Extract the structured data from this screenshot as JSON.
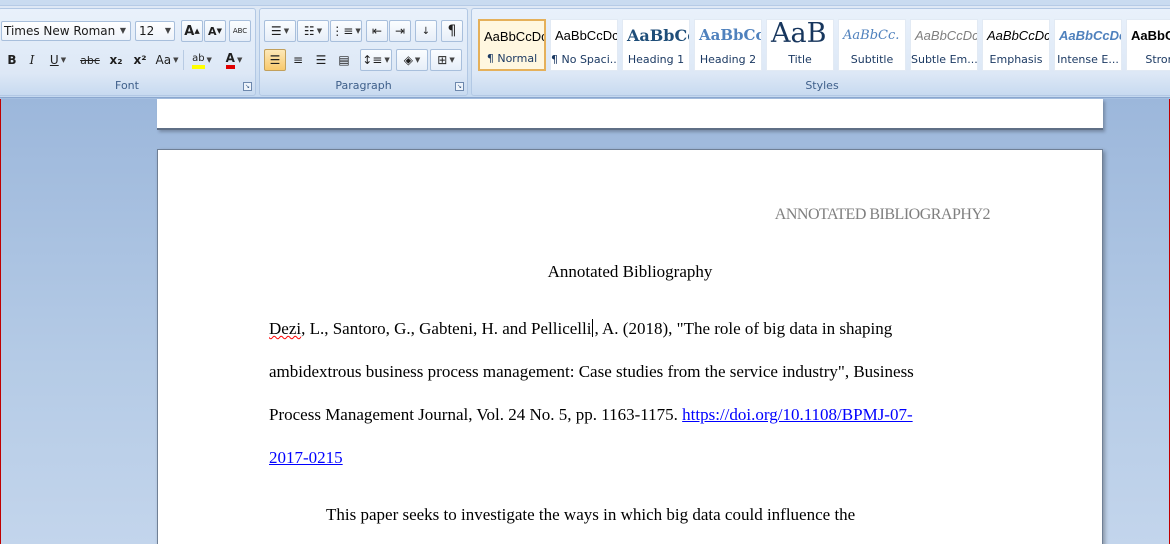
{
  "ribbon": {
    "font_group": {
      "label": "Font",
      "font_name": "Times New Roman",
      "font_size": "12",
      "grow_label": "A",
      "shrink_label": "A",
      "clear_format_label": "ABC",
      "bold": "B",
      "italic": "I",
      "underline": "U",
      "strike": "abc",
      "subscript": "x₂",
      "superscript": "x²",
      "change_case": "Aa",
      "highlight": "ab",
      "font_color": "A"
    },
    "paragraph_group": {
      "label": "Paragraph"
    },
    "styles_group": {
      "label": "Styles",
      "tiles": [
        {
          "sample": "AaBbCcDc",
          "name": "¶ Normal"
        },
        {
          "sample": "AaBbCcDc",
          "name": "¶ No Spaci..."
        },
        {
          "sample": "AaBbCc",
          "name": "Heading 1"
        },
        {
          "sample": "AaBbCc",
          "name": "Heading 2"
        },
        {
          "sample": "AaB",
          "name": "Title"
        },
        {
          "sample": "AaBbCc.",
          "name": "Subtitle"
        },
        {
          "sample": "AaBbCcDc",
          "name": "Subtle Em..."
        },
        {
          "sample": "AaBbCcDc",
          "name": "Emphasis"
        },
        {
          "sample": "AaBbCcDc",
          "name": "Intense E..."
        },
        {
          "sample": "AaBbCcDc",
          "name": "Stron"
        }
      ]
    }
  },
  "document": {
    "header": "ANNOTATED BIBLIOGRAPHY2",
    "title": "Annotated Bibliography",
    "reference": {
      "author_first": "Dezi",
      "line1_a": ", L., Santoro, G., Gabteni, H. and Pellicelli",
      "line1_b": ", A. (2018), \"The role of big data in shaping",
      "line2": "ambidextrous business process management: Case studies from the service industry\", Business",
      "line3_text": "Process Management Journal, Vol. 24 No. 5, pp. 1163-1175. ",
      "line3_link": "https://doi.org/10.1108/BPMJ-07-",
      "line4_link": "2017-0215"
    },
    "paragraph_start": "This paper seeks to investigate the ways in which big data could influence the"
  },
  "colors": {
    "accent_selected": "#e5b05a",
    "link": "#0000ff",
    "header_gray": "#7f7f7f"
  }
}
